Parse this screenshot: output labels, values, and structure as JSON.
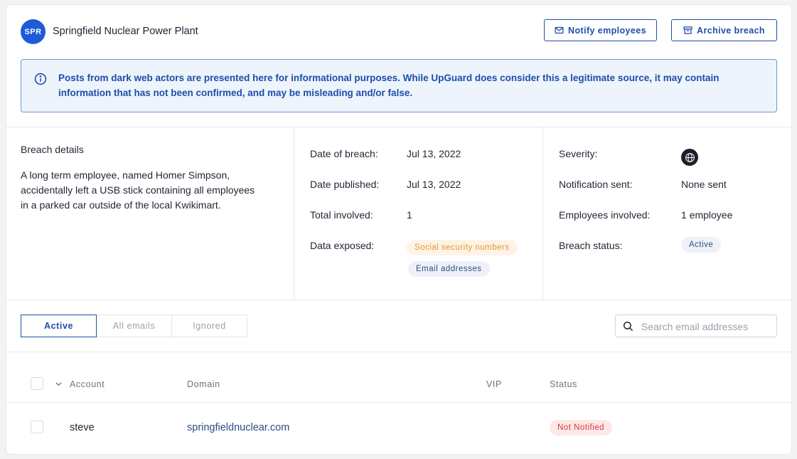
{
  "header": {
    "avatar_initials": "SPR",
    "company_name": "Springfield Nuclear Power Plant",
    "notify_label": "Notify employees",
    "archive_label": "Archive breach"
  },
  "banner": {
    "text": "Posts from dark web actors are presented here for informational purposes. While UpGuard does consider this a legitimate source, it may contain information that has not been confirmed, and may be misleading and/or false."
  },
  "details": {
    "title": "Breach details",
    "description": "A long term employee, named Homer Simpson, accidentally left a USB stick containing all employees in a parked car outside of the local Kwikimart."
  },
  "breach_info": {
    "date_of_breach_label": "Date of breach:",
    "date_of_breach": "Jul 13, 2022",
    "date_published_label": "Date published:",
    "date_published": "Jul 13, 2022",
    "total_involved_label": "Total involved:",
    "total_involved": "1",
    "data_exposed_label": "Data exposed:",
    "data_exposed": [
      "Social security numbers",
      "Email addresses"
    ]
  },
  "status_info": {
    "severity_label": "Severity:",
    "severity_icon": "globe-icon",
    "notification_label": "Notification sent:",
    "notification_value": "None sent",
    "employees_label": "Employees involved:",
    "employees_value": "1 employee",
    "status_label": "Breach status:",
    "status_value": "Active"
  },
  "tabs": [
    {
      "label": "Active",
      "active": true
    },
    {
      "label": "All emails",
      "active": false
    },
    {
      "label": "Ignored",
      "active": false
    }
  ],
  "search": {
    "placeholder": "Search email addresses",
    "value": ""
  },
  "table": {
    "columns": [
      "Account",
      "Domain",
      "VIP",
      "Status"
    ],
    "rows": [
      {
        "account": "steve",
        "domain": "springfieldnuclear.com",
        "vip": "",
        "status": "Not Notified"
      }
    ]
  },
  "colors": {
    "accent": "#1d4ea8",
    "avatar": "#1f5bd8",
    "banner_bg": "#eef4fc",
    "orange_pill": "#e39a2c",
    "red_pill": "#d33a3a"
  }
}
